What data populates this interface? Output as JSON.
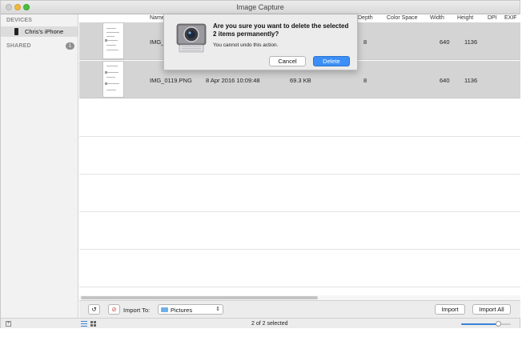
{
  "window": {
    "title": "Image Capture"
  },
  "sidebar": {
    "devices_heading": "DEVICES",
    "device_name": "Chris's iPhone",
    "shared_heading": "SHARED",
    "shared_count": "1"
  },
  "columns": [
    "Name",
    "Depth",
    "Color Space",
    "Width",
    "Height",
    "DPI",
    "EXIF"
  ],
  "rows": [
    {
      "name": "IMG_",
      "date": "",
      "size": "",
      "depth": "8",
      "width": "640",
      "height": "1136",
      "selected": true
    },
    {
      "name": "IMG_0119.PNG",
      "date": "8 Apr 2016 10:09:48",
      "size": "69.3 KB",
      "depth": "8",
      "width": "640",
      "height": "1136",
      "selected": true
    }
  ],
  "toolbar": {
    "import_to_label": "Import To:",
    "destination": "Pictures",
    "import_label": "Import",
    "import_all_label": "Import All"
  },
  "status": {
    "selection_count": "2 of 2 selected"
  },
  "thumbnail_size_fraction": 0.76,
  "dialog": {
    "title": "Are you sure you want to delete the selected 2 items permanently?",
    "message": "You cannot undo this action.",
    "cancel_label": "Cancel",
    "delete_label": "Delete"
  },
  "colors": {
    "accent": "#3b8ff6",
    "selection": "#d4d4d4"
  }
}
